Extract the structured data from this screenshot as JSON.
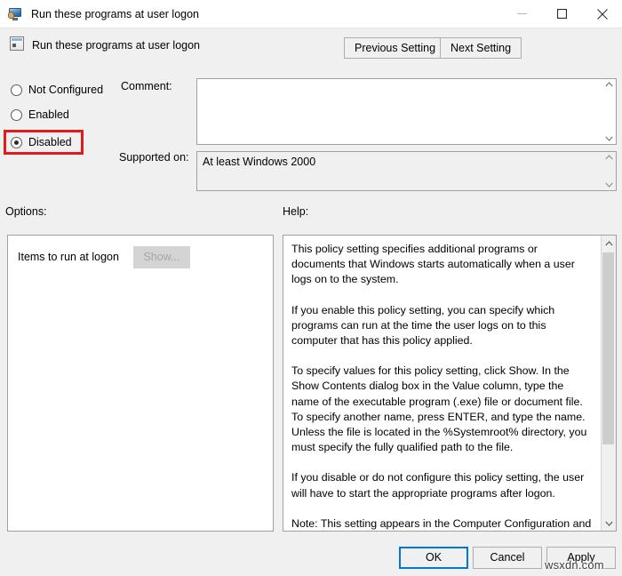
{
  "window": {
    "title": "Run these programs at user logon",
    "icon": "monitor-icon",
    "controls": {
      "minimize": "minimize-icon",
      "maximize": "maximize-icon",
      "close": "close-icon"
    }
  },
  "header": {
    "icon": "policy-setting-icon",
    "title": "Run these programs at user logon",
    "previous_button": "Previous Setting",
    "next_button": "Next Setting"
  },
  "state_options": {
    "not_configured": "Not Configured",
    "enabled": "Enabled",
    "disabled": "Disabled",
    "selected": "Disabled",
    "highlight_color": "#e01b1b"
  },
  "comment": {
    "label": "Comment:",
    "value": "",
    "placeholder": ""
  },
  "supported_on": {
    "label": "Supported on:",
    "value": "At least Windows 2000"
  },
  "options": {
    "label": "Options:",
    "item_label": "Items to run at logon",
    "show_button": "Show...",
    "show_button_enabled": false
  },
  "help": {
    "label": "Help:",
    "paragraphs": [
      "This policy setting specifies additional programs or documents that Windows starts automatically when a user logs on to the system.",
      "If you enable this policy setting, you can specify which programs can run at the time the user logs on to this computer that has this policy applied.",
      "To specify values for this policy setting, click Show. In the Show Contents dialog box in the Value column, type the name of the executable program (.exe) file or document file. To specify another name, press ENTER, and type the name. Unless the file is located in the %Systemroot% directory, you must specify the fully qualified path to the file.",
      "If you disable or do not configure this policy setting, the user will have to start the appropriate programs after logon.",
      "Note: This setting appears in the Computer Configuration and User Configuration folders. If both settings are configured, the system starts the programs specified in the Computer"
    ]
  },
  "footer": {
    "ok": "OK",
    "cancel": "Cancel",
    "apply": "Apply"
  },
  "watermark": "wsxdn.com"
}
